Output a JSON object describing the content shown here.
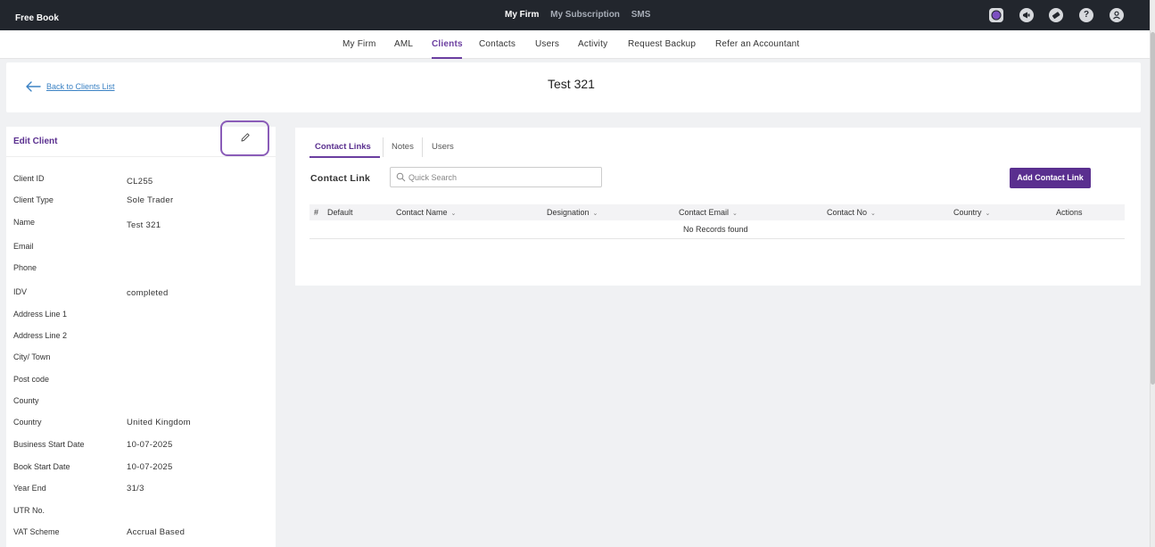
{
  "topbar": {
    "brand": "Free Book",
    "nav": [
      "My Firm",
      "My Subscription",
      "SMS"
    ],
    "active_nav": "My Firm",
    "icons": [
      "app-circle-icon",
      "megaphone-icon",
      "ticket-icon",
      "help-icon",
      "user-icon"
    ],
    "help_glyph": "?"
  },
  "subnav": {
    "items": [
      "My Firm",
      "AML",
      "Clients",
      "Contacts",
      "Users",
      "Activity",
      "Request Backup",
      "Refer an Accountant"
    ],
    "active": "Clients"
  },
  "header": {
    "back_label": "Back to Clients List",
    "title": "Test 321"
  },
  "client": {
    "title": "Edit Client",
    "fields": [
      {
        "label": "Client ID",
        "value": "CL255"
      },
      {
        "label": "Client Type",
        "value": "Sole Trader"
      },
      {
        "label": "Name",
        "value": "Test 321"
      },
      {
        "label": "Email",
        "value": ""
      },
      {
        "label": "Phone",
        "value": ""
      },
      {
        "label": "IDV",
        "value": "completed"
      },
      {
        "label": "Address Line 1",
        "value": ""
      },
      {
        "label": "Address Line 2",
        "value": ""
      },
      {
        "label": "City/ Town",
        "value": ""
      },
      {
        "label": "Post code",
        "value": ""
      },
      {
        "label": "County",
        "value": ""
      },
      {
        "label": "Country",
        "value": "United Kingdom"
      },
      {
        "label": "Business Start Date",
        "value": "10-07-2025"
      },
      {
        "label": "Book Start Date",
        "value": "10-07-2025"
      },
      {
        "label": "Year End",
        "value": "31/3"
      },
      {
        "label": "UTR No.",
        "value": ""
      },
      {
        "label": "VAT Scheme",
        "value": "Accrual Based"
      }
    ]
  },
  "tabs": [
    "Contact Links",
    "Notes",
    "Users"
  ],
  "active_tab": "Contact Links",
  "contact_links": {
    "title": "Contact Link",
    "search_placeholder": "Quick Search",
    "add_button": "Add Contact Link",
    "columns": [
      "#",
      "Default",
      "Contact Name",
      "Designation",
      "Contact Email",
      "Contact No",
      "Country",
      "Actions"
    ],
    "sortable_columns": [
      "Contact Name",
      "Designation",
      "Contact Email",
      "Contact No",
      "Country"
    ],
    "empty_text": "No Records found"
  },
  "colors": {
    "accent": "#5a2f8f",
    "topbar": "#22262d",
    "link": "#3b82c4"
  }
}
